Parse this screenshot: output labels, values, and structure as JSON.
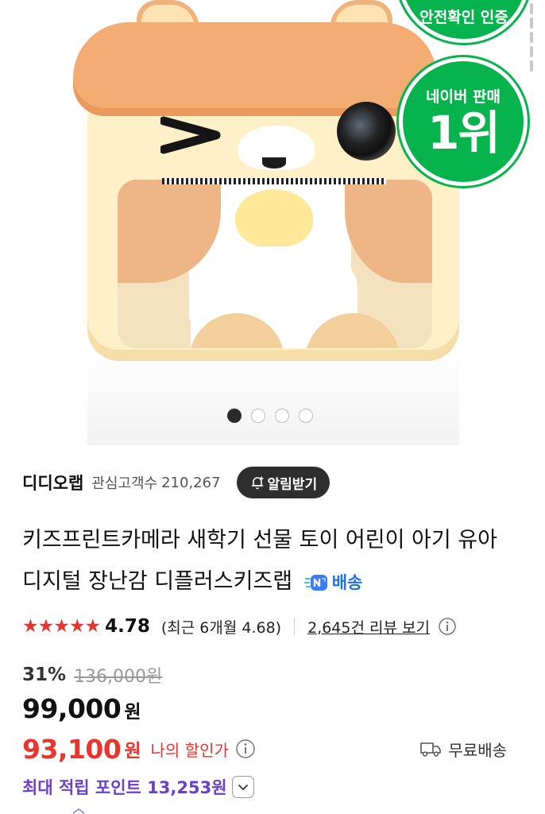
{
  "hero": {
    "badge_top_label": "안전확인 인증",
    "badge_main_line1": "네이버 판매",
    "badge_main_line2": "1위",
    "carousel": {
      "total": 4,
      "active_index": 0
    }
  },
  "store": {
    "name": "디디오랩",
    "followers_label": "관심고객수",
    "followers_count": "210,267",
    "alarm_button_label": "알림받기"
  },
  "product": {
    "title": "키즈프린트카메라 새학기 선물 토이 어린이 아기 유아 디지털 장난감 디플러스키즈랩",
    "delivery_label": "배송"
  },
  "rating": {
    "stars": "★★★★★",
    "value": "4.78",
    "recent": "(최근 6개월 4.68)",
    "review_link": "2,645건 리뷰 보기"
  },
  "price": {
    "discount": "31%",
    "original": "136,000원",
    "sale": "99,000",
    "won": "원",
    "my_price": "93,100",
    "my_won": "원",
    "my_label": "나의 할인가",
    "shipping_label": "무료배송"
  },
  "points": {
    "label": "최대 적립 포인트 13,253원"
  },
  "colors": {
    "accent_red": "#e8352e",
    "points_purple": "#6a3fcf",
    "badge_green": "#07b34c",
    "delivery_blue": "#1a73e8"
  }
}
